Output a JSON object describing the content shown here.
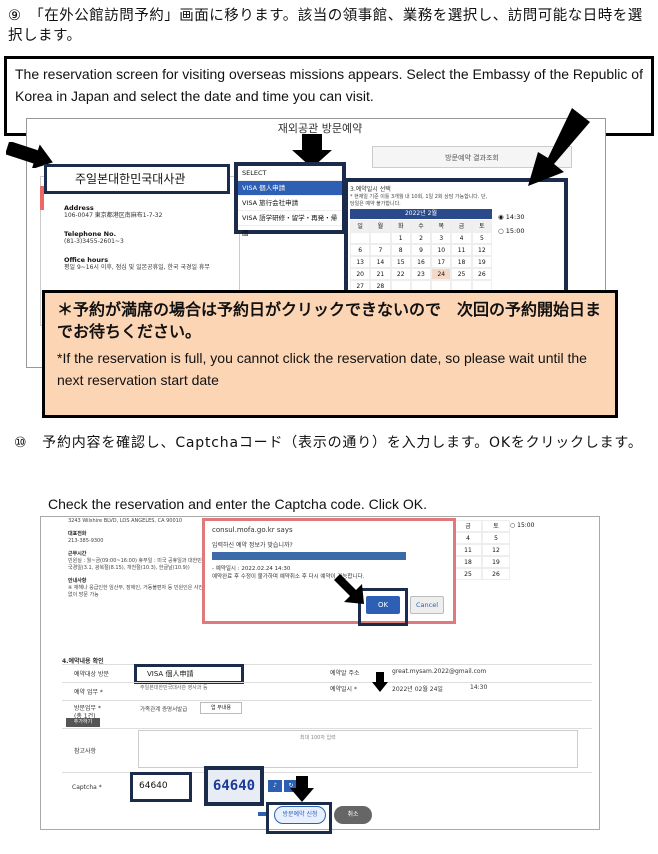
{
  "step9": {
    "jp": "⑨　「在外公館訪問予約」画面に移ります。該当の領事館、業務を選択し、訪問可能な日時を選択します。",
    "en": "The reservation screen for visiting overseas missions appears. Select the Embassy of the Republic of Korea in Japan and select the date and time you can visit."
  },
  "shot1": {
    "title": "재외공관 방문예약",
    "result_tab": "방문예약 결과조회",
    "embassy": "주일본대한민국대사관",
    "address_label": "Address",
    "address_value": "106-0047 東京都港区南麻布1-7-32",
    "phone_label": "Telephone No.",
    "phone_value": "(81-3)3455-2601~3",
    "hours_label": "Office hours",
    "hours_value": "평일 9~16시 이후, 점심 및 일본공휴일, 한국 국경일 휴무",
    "options": [
      "SELECT",
      "VISA 個人申請",
      "VISA 旅行会社申請",
      "VISA 語学研修・留学・再発・帰国"
    ],
    "calendar_title": "3.예약일시 선택",
    "calendar_note": "* 현재일 기준 이틀 3개월 내 10회, 1일 2회 상담 가능합니다. 단, 당일은 예약 불가합니다.",
    "month": "2022년 2월",
    "weekdays": [
      "일",
      "월",
      "화",
      "수",
      "목",
      "금",
      "토"
    ],
    "rows": [
      [
        "",
        "",
        "1",
        "2",
        "3",
        "4",
        "5"
      ],
      [
        "6",
        "7",
        "8",
        "9",
        "10",
        "11",
        "12"
      ],
      [
        "13",
        "14",
        "15",
        "16",
        "17",
        "18",
        "19"
      ],
      [
        "20",
        "21",
        "22",
        "23",
        "24",
        "25",
        "26"
      ],
      [
        "27",
        "28",
        "",
        "",
        "",
        "",
        ""
      ]
    ],
    "times": [
      "◉ 14:30",
      "○ 15:00"
    ]
  },
  "warning": {
    "jp": "＊予約が満席の場合は予約日がクリックできないので　次回の予約開始日までお待ちください。",
    "en": "*If the reservation is full, you cannot click the reservation date, so please wait until the next reservation start date"
  },
  "step10": {
    "jp": "⑩　予約内容を確認し、Captchaコード（表示の通り）を入力します。OKをクリックします。",
    "en": "Check the reservation and enter the Captcha code. Click OK."
  },
  "shot2": {
    "addr": "3243 Wilshire BLVD, LOS ANGELES, CA 90010",
    "phone_lbl": "대표전화",
    "phone_val": "213-385-9300",
    "hours_lbl": "근무시간",
    "hours_val": "민원실 : 월~금(09:00~16:00) 휴무일 : 미국 공휴일과 대한민국 3대 국경일(3.1, 광복절(8.15), 개천절(10.3), 한글날(10.9))",
    "guide_lbl": "안내사항",
    "guide_val": "※ 재해나 응급인한 임산부, 장애인, 거동불편자 등 민원인은 사전 예약 없이 방문 가능",
    "cal_right": [
      "금",
      "토",
      "4",
      "5",
      "11",
      "12",
      "18",
      "19",
      "25",
      "26"
    ],
    "time_right": "○ 15:00",
    "dialog_host": "consul.mofa.go.kr says",
    "dialog_q": "입력하신 예약 정보가 맞습니까?",
    "dialog_line1": "- 예약일시 : 2022.02.24 14:30",
    "dialog_line2": "예약완료 후 수정이 불가하며 예약취소 후 다시 예약이 가능합니다.",
    "ok": "OK",
    "cancel": "Cancel",
    "section": "4.예약내용 확인",
    "visit_place_lbl": "예약대상 방문",
    "visa": "VISA 個人申請",
    "visa_sub": "주일본대한민국대사관 영사과 등",
    "email_lbl": "예약알 주소",
    "email_val": "great.mysam.2022@gmail.com",
    "date_lbl": "예약일시 *",
    "date_val": "2022년 02월 24일",
    "time_val": "14:30",
    "reg_lbl": "예약 업무 *",
    "type_lbl": "방문업무 *",
    "type_sub": "(총 1건)",
    "add_btn": "추가하기",
    "doc_lbl": "가족관계 증명서발급",
    "upload": "업 무내용",
    "notes_lbl": "참고사항",
    "notes_ph": "최대 100자 입력",
    "captcha_lbl": "Captcha *",
    "captcha_input": "64640",
    "captcha_img": "64640",
    "submit": "방문예약 신청",
    "cancel2": "취소"
  }
}
